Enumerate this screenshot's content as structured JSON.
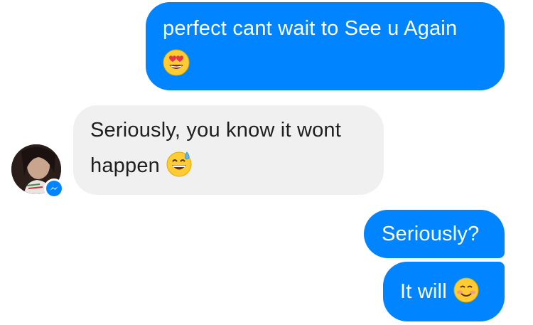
{
  "conversation": {
    "messages": [
      {
        "direction": "outgoing",
        "line1": "perfect cant wait to See u Again",
        "emoji": "heart-eyes-emoji"
      },
      {
        "direction": "incoming",
        "line1": "Seriously, you know it wont",
        "line2": "happen",
        "emoji": "grinning-sweat-emoji"
      },
      {
        "direction": "outgoing",
        "text": "Seriously?"
      },
      {
        "direction": "outgoing",
        "text": "It will",
        "emoji": "smiling-blush-emoji"
      }
    ]
  },
  "contact": {
    "avatar_icon": "avatar-photo",
    "badge_icon": "messenger-icon"
  },
  "colors": {
    "outgoing_bubble": "#0084ff",
    "incoming_bubble": "#f1f0f0",
    "outgoing_text": "#ffffff",
    "incoming_text": "#1f1f1f"
  }
}
